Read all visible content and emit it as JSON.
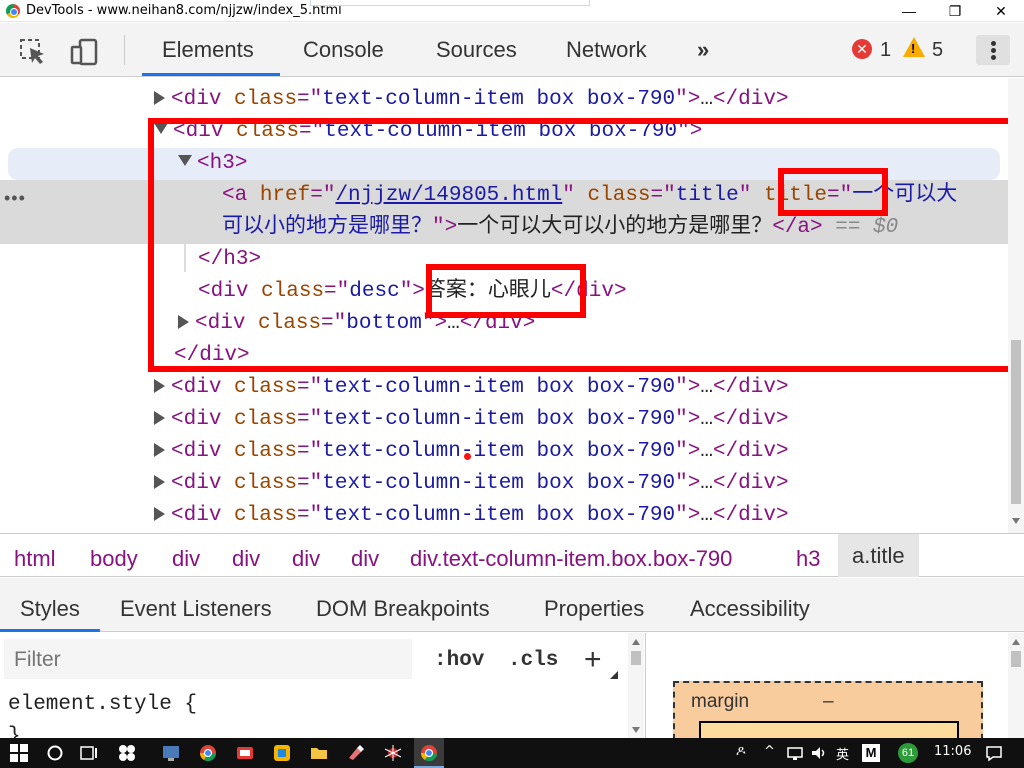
{
  "window": {
    "title": "DevTools - www.neihan8.com/njjzw/index_5.html",
    "minimize": "—",
    "maximize": "❐",
    "close": "✕"
  },
  "toolbar": {
    "tabs": [
      "Elements",
      "Console",
      "Sources",
      "Network"
    ],
    "more": "»",
    "errors": "1",
    "warnings": "5"
  },
  "dom": {
    "collapsed_row": {
      "tag": "div",
      "attr": "class",
      "value": "text-column-item box box-790",
      "ellipsis": "…"
    },
    "open_div": {
      "tag": "div",
      "attr": "class",
      "value": "text-column-item box box-790"
    },
    "h3": {
      "tag": "h3"
    },
    "anchor": {
      "href_attr": "href",
      "href": "/njjzw/149805.html",
      "class_attr": "class",
      "class_val": "title",
      "title_attr": "title",
      "title_val_1": "一个可以大",
      "title_val_2": "可以小的地方是哪里？",
      "text": "一个可以大可以小的地方是哪里？",
      "eq": "== $0"
    },
    "desc": {
      "tag": "div",
      "attr": "class",
      "value": "desc",
      "text": "答案：心眼儿"
    },
    "bottom": {
      "tag": "div",
      "attr": "class",
      "value": "bottom",
      "ellipsis": "…"
    },
    "close_div": "div",
    "close_h3": "h3",
    "dots": "•••"
  },
  "breadcrumbs": [
    "html",
    "body",
    "div",
    "div",
    "div",
    "div",
    "div.text-column-item.box.box-790",
    "h3",
    "a.title"
  ],
  "subtabs": [
    "Styles",
    "Event Listeners",
    "DOM Breakpoints",
    "Properties",
    "Accessibility"
  ],
  "styles": {
    "filter_placeholder": "Filter",
    "hov": ":hov",
    "cls": ".cls",
    "plus": "+",
    "element_style": "element.style {",
    "close_brace": "}"
  },
  "boxmodel": {
    "margin_label": "margin",
    "margin_value": "–"
  },
  "taskbar": {
    "ime": "英",
    "m": "M",
    "badge": "61",
    "time": "11:06",
    "person": "ዶ"
  }
}
